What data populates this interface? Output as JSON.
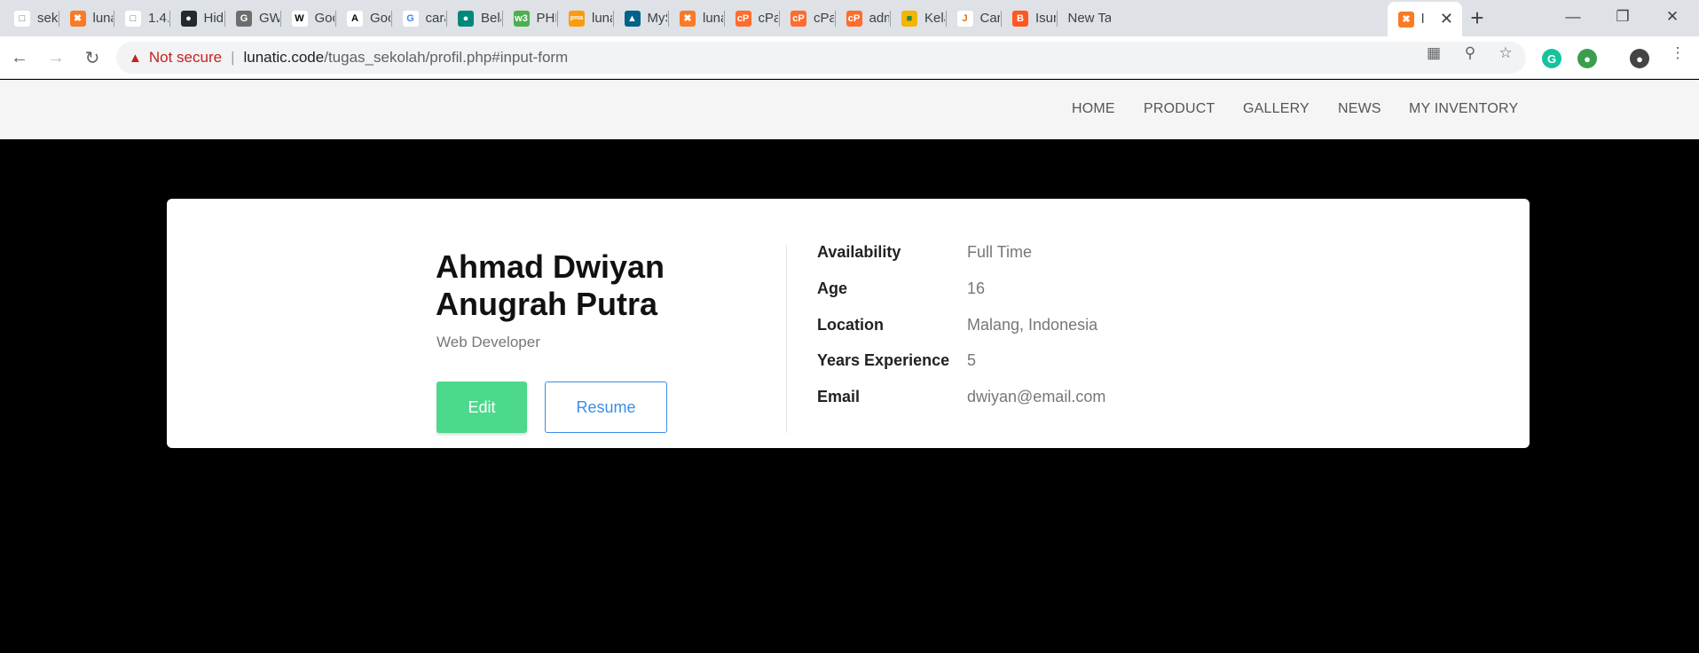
{
  "browser": {
    "tabs": [
      {
        "title": "seko",
        "icon": "document-icon"
      },
      {
        "title": "luna",
        "icon": "xampp-icon"
      },
      {
        "title": "1.4.",
        "icon": "document-icon"
      },
      {
        "title": "Hidd",
        "icon": "github-icon"
      },
      {
        "title": "GWS",
        "icon": "gws-icon"
      },
      {
        "title": "Goo",
        "icon": "wikipedia-icon"
      },
      {
        "title": "Goo",
        "icon": "google-fonts-icon"
      },
      {
        "title": "cara",
        "icon": "google-icon"
      },
      {
        "title": "Bela",
        "icon": "teal-circle-icon"
      },
      {
        "title": "PHP",
        "icon": "w3schools-icon"
      },
      {
        "title": "luna",
        "icon": "phpmyadmin-icon"
      },
      {
        "title": "MyS",
        "icon": "mysql-icon"
      },
      {
        "title": "luna",
        "icon": "xampp-icon"
      },
      {
        "title": "cPar",
        "icon": "cpanel-icon"
      },
      {
        "title": "cPar",
        "icon": "cpanel-icon"
      },
      {
        "title": "adm",
        "icon": "cpanel-icon"
      },
      {
        "title": "Kela",
        "icon": "classroom-icon"
      },
      {
        "title": "Cara",
        "icon": "java-icon"
      },
      {
        "title": "Isura",
        "icon": "blogger-icon"
      },
      {
        "title": "New Tab",
        "icon": ""
      },
      {
        "title": "l",
        "icon": "xampp-icon",
        "active": true
      }
    ],
    "security_label": "Not secure",
    "url_host": "lunatic.code",
    "url_path": "/tugas_sekolah/profil.php#input-form"
  },
  "nav": {
    "items": [
      "HOME",
      "PRODUCT",
      "GALLERY",
      "NEWS",
      "MY INVENTORY"
    ]
  },
  "profile": {
    "name_line1": "Ahmad Dwiyan",
    "name_line2": "Anugrah Putra",
    "role": "Web Developer",
    "edit_label": "Edit",
    "resume_label": "Resume",
    "details": [
      {
        "label": "Availability",
        "value": "Full Time"
      },
      {
        "label": "Age",
        "value": "16"
      },
      {
        "label": "Location",
        "value": "Malang, Indonesia"
      },
      {
        "label": "Years Experience",
        "value": "5"
      },
      {
        "label": "Email",
        "value": "dwiyan@email.com"
      }
    ]
  },
  "colors": {
    "edit_button": "#4cd98c",
    "resume_border": "#3b8ee8",
    "page_background": "#000000",
    "nav_background": "#f5f5f5"
  }
}
